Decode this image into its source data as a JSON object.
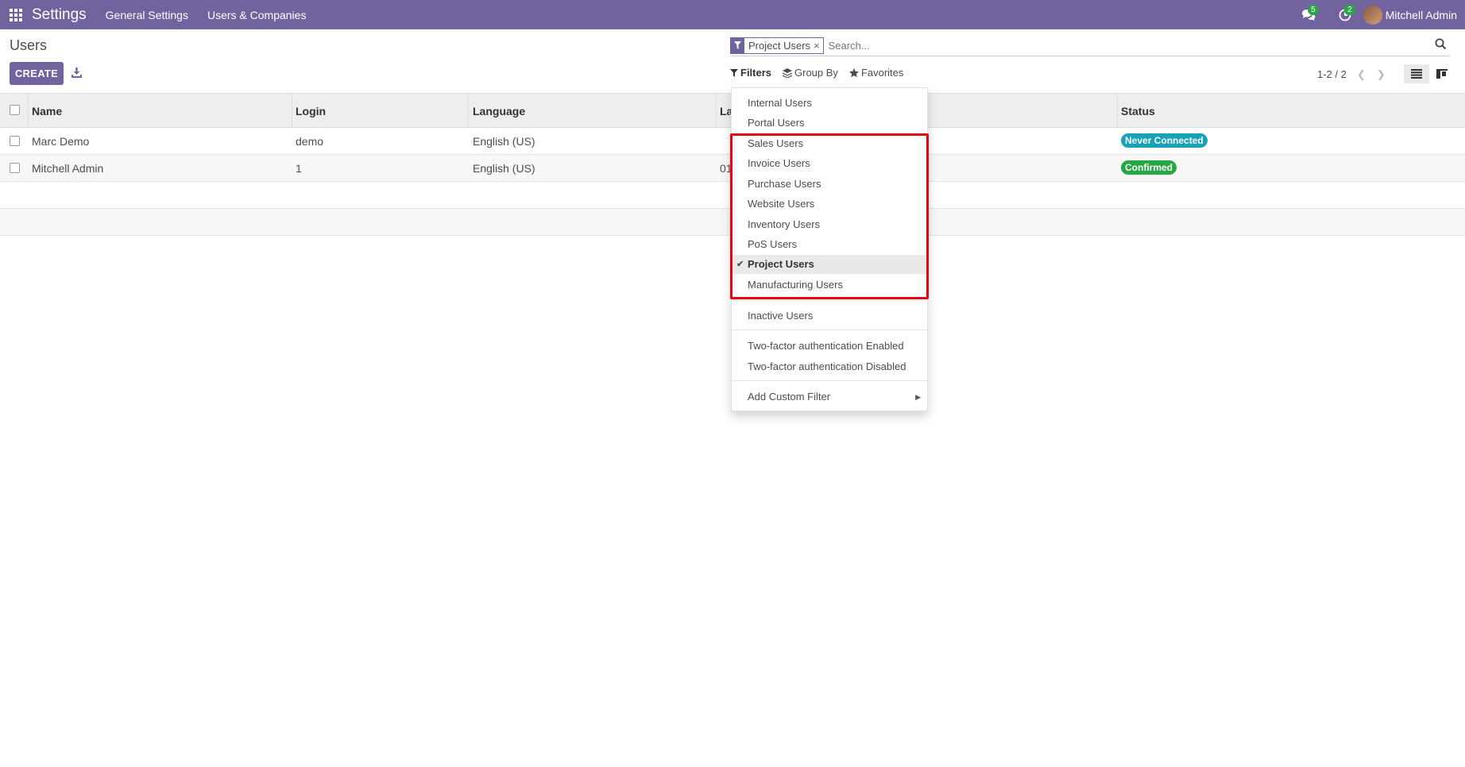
{
  "navbar": {
    "brand": "Settings",
    "menu": [
      "General Settings",
      "Users & Companies"
    ],
    "messages_count": "5",
    "activities_count": "2",
    "user_name": "Mitchell Admin"
  },
  "control_panel": {
    "breadcrumb": "Users",
    "create_label": "CREATE",
    "search_facet": "Project Users",
    "search_placeholder": "Search...",
    "filters_label": "Filters",
    "groupby_label": "Group By",
    "favorites_label": "Favorites",
    "pager_value": "1-2 / 2"
  },
  "table": {
    "headers": [
      "Name",
      "Login",
      "Language",
      "La",
      "Status"
    ],
    "rows": [
      {
        "name": "Marc Demo",
        "login": "demo",
        "language": "English (US)",
        "latest": "",
        "status": "Never Connected"
      },
      {
        "name": "Mitchell Admin",
        "login": "1",
        "language": "English (US)",
        "latest": "01",
        "status": "Confirmed"
      }
    ]
  },
  "filters_dropdown": {
    "items": [
      "Internal Users",
      "Portal Users",
      "Sales Users",
      "Invoice Users",
      "Purchase Users",
      "Website Users",
      "Inventory Users",
      "PoS Users",
      "Project Users",
      "Manufacturing Users",
      "Inactive Users",
      "Two-factor authentication Enabled",
      "Two-factor authentication Disabled",
      "Add Custom Filter"
    ],
    "selected": "Project Users"
  },
  "colors": {
    "brand": "#71639e",
    "status_info": "#17a2b8",
    "status_success": "#28a745",
    "highlight": "#e30613"
  }
}
